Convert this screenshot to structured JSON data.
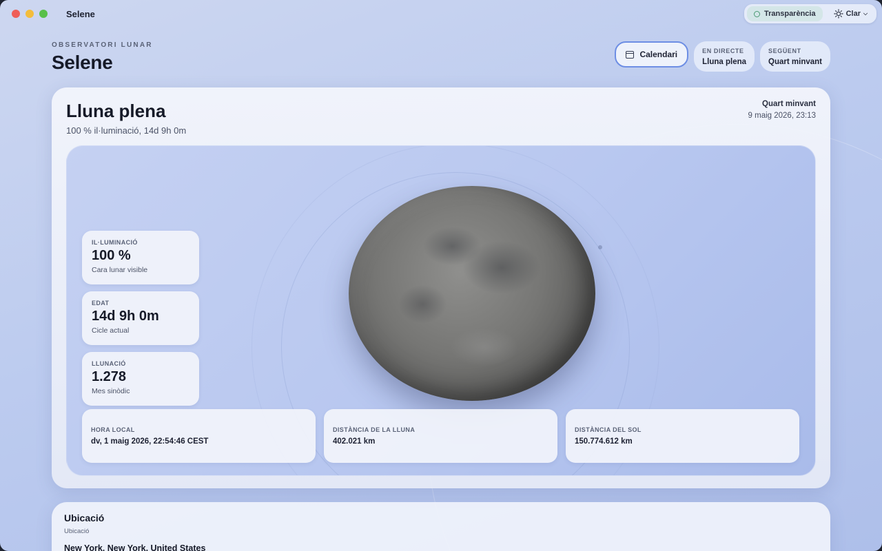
{
  "window": {
    "title": "Selene"
  },
  "top_controls": {
    "transparency_label": "Transparència",
    "theme_label": "Clar"
  },
  "header": {
    "eyebrow": "OBSERVATORI LUNAR",
    "title": "Selene",
    "calendar_label": "Calendari",
    "live": {
      "label": "EN DIRECTE",
      "value": "Lluna plena"
    },
    "next": {
      "label": "SEGÜENT",
      "value": "Quart minvant"
    }
  },
  "phase": {
    "name": "Lluna plena",
    "subtitle": "100 % il·luminació, 14d 9h 0m",
    "next_name": "Quart minvant",
    "next_date": "9 maig 2026, 23:13"
  },
  "stats": [
    {
      "label": "IL·LUMINACIÓ",
      "value": "100 %",
      "sub": "Cara lunar visible"
    },
    {
      "label": "EDAT",
      "value": "14d 9h 0m",
      "sub": "Cicle actual"
    },
    {
      "label": "LLUNACIÓ",
      "value": "1.278",
      "sub": "Mes sinòdic"
    }
  ],
  "info": [
    {
      "label": "HORA LOCAL",
      "value": "dv, 1 maig 2026, 22:54:46 CEST"
    },
    {
      "label": "DISTÀNCIA DE LA LLUNA",
      "value": "402.021 km"
    },
    {
      "label": "DISTÀNCIA DEL SOL",
      "value": "150.774.612 km"
    }
  ],
  "location": {
    "title": "Ubicació",
    "subtitle": "Ubicació",
    "value": "New York, New York, United States"
  },
  "colors": {
    "accent": "#6d8ee4",
    "close": "#ee5d57",
    "minimize": "#f3bd3c",
    "maximize": "#58c049"
  }
}
